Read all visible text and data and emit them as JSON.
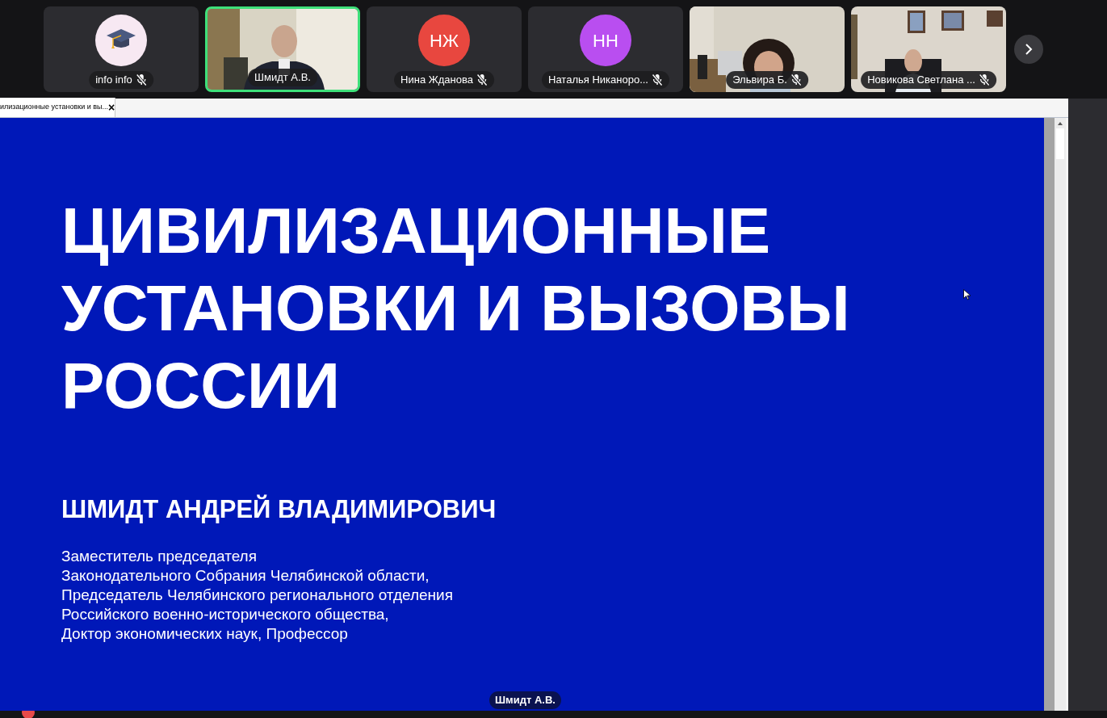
{
  "participants": [
    {
      "kind": "avatar",
      "name": "info info",
      "muted": true,
      "speaking": false
    },
    {
      "kind": "video",
      "name": "Шмидт А.В.",
      "muted": false,
      "speaking": true
    },
    {
      "kind": "initials",
      "initials": "НЖ",
      "color": "#e8473f",
      "name": "Нина Жданова",
      "muted": true,
      "speaking": false
    },
    {
      "kind": "initials",
      "initials": "НН",
      "color": "#b94ef0",
      "name": "Наталья Никаноро...",
      "muted": true,
      "speaking": false
    },
    {
      "kind": "video",
      "name": "Эльвира Б.",
      "muted": true,
      "speaking": false
    },
    {
      "kind": "video",
      "name": "Новикова Светлана ...",
      "muted": true,
      "speaking": false
    }
  ],
  "document_tab": {
    "title": "илизационные установки и вы...",
    "close": "×"
  },
  "slide": {
    "title_lines": [
      "ЦИВИЛИЗАЦИОННЫЕ",
      "УСТАНОВКИ И ВЫЗОВЫ",
      "РОССИИ"
    ],
    "author": "ШМИДТ АНДРЕЙ ВЛАДИМИРОВИЧ",
    "position_lines": [
      "Заместитель председателя",
      "Законодательного Собрания Челябинской области,",
      "Председатель Челябинского регионального отделения",
      "Российского военно-исторического общества,",
      "Доктор экономических наук, Профессор"
    ]
  },
  "presenter_tag": "Шмидт А.В."
}
